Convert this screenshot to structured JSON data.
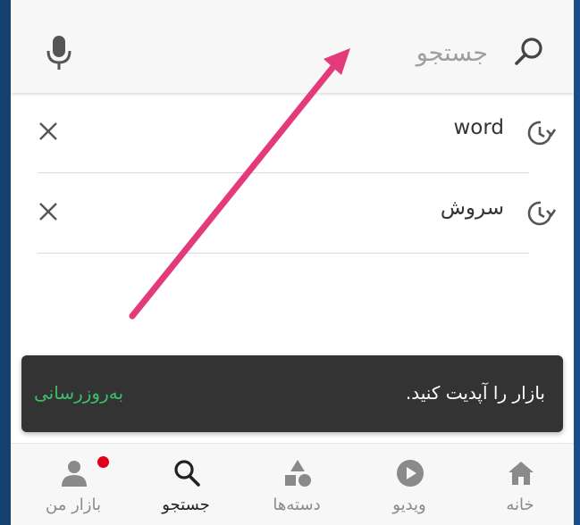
{
  "search": {
    "placeholder": "جستجو"
  },
  "history": [
    {
      "label": "word"
    },
    {
      "label": "سروش"
    }
  ],
  "snackbar": {
    "message": "بازار را آپدیت کنید.",
    "action": "به‌روزرسانی"
  },
  "bottom_nav": {
    "home": "خانه",
    "video": "ویدیو",
    "categories": "دسته‌ها",
    "search": "جستجو",
    "my_bazaar": "بازار من"
  },
  "colors": {
    "accent_green": "#3ac069",
    "badge_red": "#e0001b",
    "arrow_pink": "#e23a7a"
  }
}
